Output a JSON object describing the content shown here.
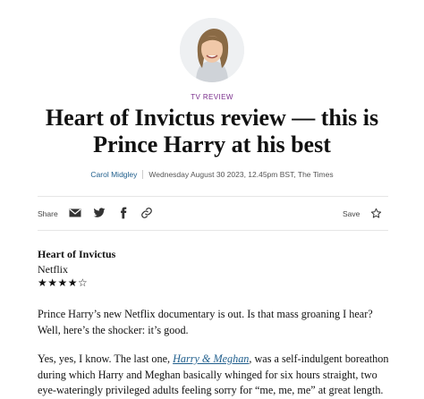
{
  "author_avatar": {
    "alt": "Carol Midgley"
  },
  "article": {
    "section": "TV REVIEW",
    "headline": "Heart of Invictus review — this is Prince Harry at his best",
    "byline": {
      "author": "Carol Midgley",
      "dateline": "Wednesday August 30 2023, 12.45pm BST, The Times"
    },
    "review": {
      "title": "Heart of Invictus",
      "network": "Netflix",
      "rating_stars": "★★★★☆",
      "rating": 4,
      "rating_max": 5
    },
    "paragraphs": {
      "p1": "Prince Harry’s new Netflix documentary is out. Is that mass groaning I hear? Well, here’s the shocker: it’s good.",
      "p2_before": "Yes, yes, I know. The last one, ",
      "p2_link": "Harry & Meghan",
      "p2_after": ", was a self-indulgent boreathon during which Harry and Meghan basically whinged for six hours straight, two eye-wateringly privileged adults feeling sorry for “me, me, me” at great length."
    }
  },
  "toolbar": {
    "share_label": "Share",
    "share_icons": [
      "mail-icon",
      "twitter-icon",
      "facebook-icon",
      "link-icon"
    ],
    "save_label": "Save",
    "save_icon": "star-outline-icon"
  },
  "colors": {
    "section": "#7a2e8c",
    "link": "#1f5e8c",
    "text": "#111111",
    "rule": "#e6e6e6"
  }
}
